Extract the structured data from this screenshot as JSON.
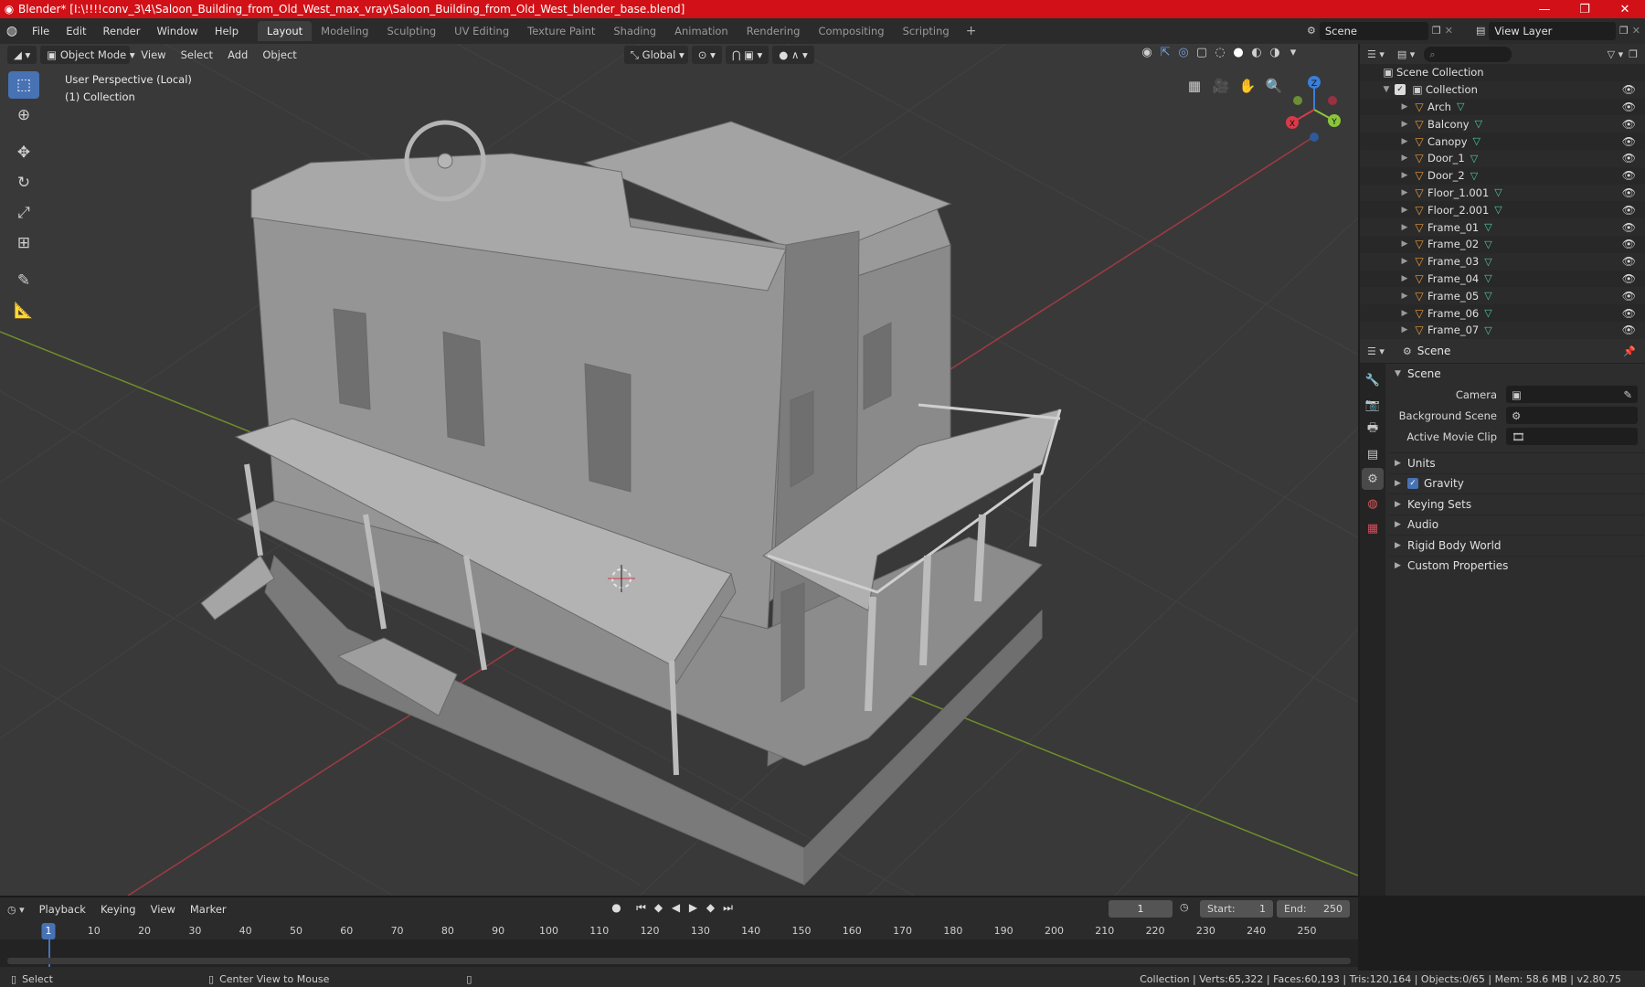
{
  "window": {
    "title": "Blender* [I:\\!!!!conv_3\\4\\Saloon_Building_from_Old_West_max_vray\\Saloon_Building_from_Old_West_blender_base.blend]",
    "controls": [
      "—",
      "❐",
      "✕"
    ]
  },
  "menu": [
    "File",
    "Edit",
    "Render",
    "Window",
    "Help"
  ],
  "workspaces": [
    "Layout",
    "Modeling",
    "Sculpting",
    "UV Editing",
    "Texture Paint",
    "Shading",
    "Animation",
    "Rendering",
    "Compositing",
    "Scripting"
  ],
  "active_workspace": "Layout",
  "scene_selector": "Scene",
  "view_layer": "View Layer",
  "viewport": {
    "mode": "Object Mode",
    "menus": [
      "View",
      "Select",
      "Add",
      "Object"
    ],
    "orientation": "Global",
    "info_line1": "User Perspective (Local)",
    "info_line2": "(1) Collection",
    "gizmo": {
      "x": "X",
      "y": "Y",
      "z": "Z"
    }
  },
  "outliner": {
    "root": "Scene Collection",
    "collection": "Collection",
    "items": [
      "Arch",
      "Balcony",
      "Canopy",
      "Door_1",
      "Door_2",
      "Floor_1.001",
      "Floor_2.001",
      "Frame_01",
      "Frame_02",
      "Frame_03",
      "Frame_04",
      "Frame_05",
      "Frame_06",
      "Frame_07"
    ]
  },
  "properties": {
    "header": "Scene",
    "panel": "Scene",
    "camera_label": "Camera",
    "background_scene_label": "Background Scene",
    "active_movie_clip_label": "Active Movie Clip",
    "subpanels": {
      "units": "Units",
      "gravity": "Gravity",
      "keying_sets": "Keying Sets",
      "audio": "Audio",
      "rigid_body_world": "Rigid Body World",
      "custom_properties": "Custom Properties"
    }
  },
  "timeline": {
    "menus": [
      "Playback",
      "Keying",
      "View",
      "Marker"
    ],
    "current_frame": "1",
    "start_label": "Start:",
    "start": "1",
    "end_label": "End:",
    "end": "250",
    "ruler": [
      "1",
      "10",
      "20",
      "30",
      "40",
      "50",
      "60",
      "70",
      "80",
      "90",
      "100",
      "110",
      "120",
      "130",
      "140",
      "150",
      "160",
      "170",
      "180",
      "190",
      "200",
      "210",
      "220",
      "230",
      "240",
      "250"
    ]
  },
  "status": {
    "left": "Select",
    "middle": "Center View to Mouse",
    "right": "Collection | Verts:65,322 | Faces:60,193 | Tris:120,164 | Objects:0/65 | Mem: 58.6 MB | v2.80.75"
  },
  "colors": {
    "titlebar": "#d11117",
    "accent": "#4772b3",
    "object_icon": "#e99a3a",
    "mesh_icon": "#4ec9a3",
    "axis_x": "#d83a4a",
    "axis_y": "#8bc63a",
    "axis_z": "#3a7fd8"
  }
}
